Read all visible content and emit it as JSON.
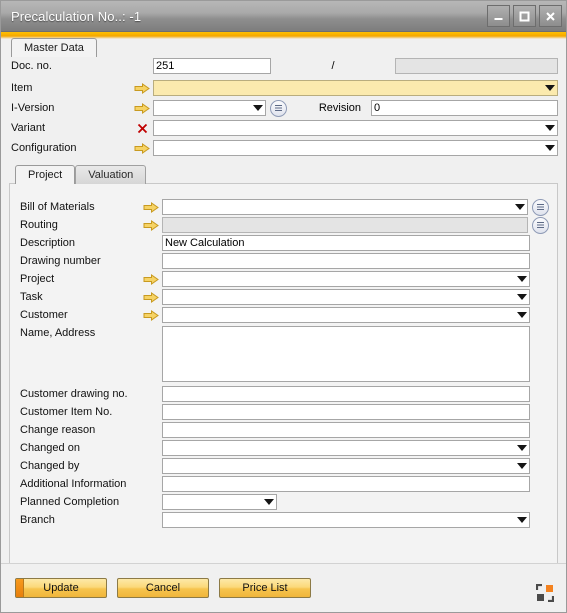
{
  "window": {
    "title": "Precalculation No..: -1",
    "controls": [
      {
        "name": "minimize",
        "glyph": "_"
      },
      {
        "name": "maximize",
        "glyph": "□"
      },
      {
        "name": "close",
        "glyph": "✕"
      }
    ]
  },
  "outer_tabs": [
    {
      "label": "Master Data",
      "active": true
    }
  ],
  "header_fields": {
    "doc_no": {
      "label": "Doc. no.",
      "value": "251",
      "separator": "/",
      "second_value": ""
    },
    "item": {
      "label": "Item",
      "value": "",
      "icon": "link-arrow-icon"
    },
    "i_version": {
      "label": "I-Version",
      "value": "",
      "icon": "link-arrow-icon"
    },
    "revision": {
      "label": "Revision",
      "value": "0"
    },
    "variant": {
      "label": "Variant",
      "value": "",
      "icon": "red-x-icon"
    },
    "configuration": {
      "label": "Configuration",
      "value": "",
      "icon": "link-arrow-icon"
    }
  },
  "inner_tabs": [
    {
      "label": "Project",
      "active": true
    },
    {
      "label": "Valuation",
      "active": false
    }
  ],
  "project_fields": {
    "bill_of_materials": {
      "label": "Bill of Materials",
      "value": ""
    },
    "routing": {
      "label": "Routing",
      "value": ""
    },
    "description": {
      "label": "Description",
      "value": "New Calculation"
    },
    "drawing_number": {
      "label": "Drawing number",
      "value": ""
    },
    "project": {
      "label": "Project",
      "value": ""
    },
    "task": {
      "label": "Task",
      "value": ""
    },
    "customer": {
      "label": "Customer",
      "value": ""
    },
    "name_address": {
      "label": "Name, Address",
      "value": ""
    },
    "customer_drawing_no": {
      "label": "Customer drawing no.",
      "value": ""
    },
    "customer_item_no": {
      "label": "Customer Item No.",
      "value": ""
    },
    "change_reason": {
      "label": "Change reason",
      "value": ""
    },
    "changed_on": {
      "label": "Changed on",
      "value": ""
    },
    "changed_by": {
      "label": "Changed by",
      "value": ""
    },
    "additional_information": {
      "label": "Additional Information",
      "value": ""
    },
    "planned_completion": {
      "label": "Planned Completion",
      "value": ""
    },
    "branch": {
      "label": "Branch",
      "value": ""
    }
  },
  "footer": {
    "update": "Update",
    "cancel": "Cancel",
    "price_list": "Price List",
    "resize_icon": "resize-grip-icon"
  },
  "colors": {
    "accent": "#f5a800",
    "required_field": "#fbeaae",
    "button_orange": "#f79a1e",
    "link_arrow": "#f2c14a",
    "error_x": "#c00000"
  }
}
